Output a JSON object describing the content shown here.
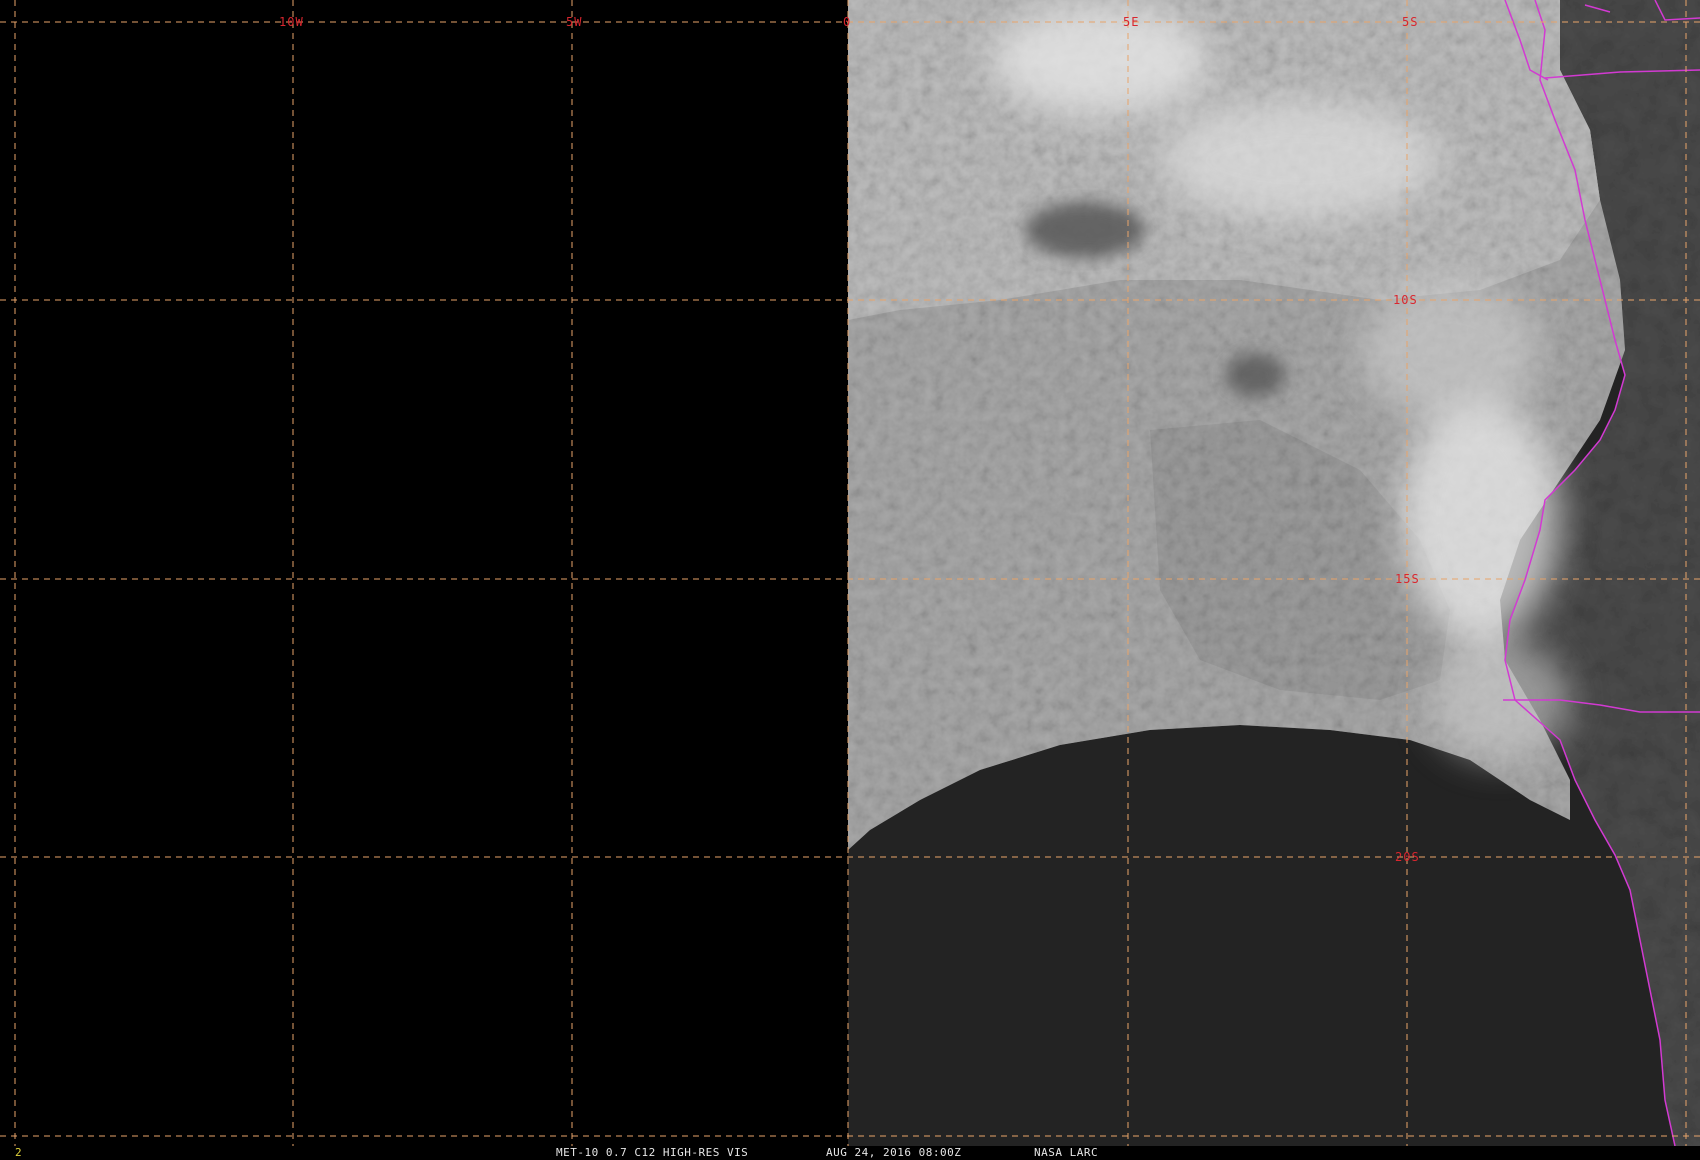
{
  "grid_labels": {
    "longitude": [
      "10W",
      "5W",
      "0",
      "5E",
      "5S"
    ],
    "latitude": [
      "10S",
      "15S",
      "20S"
    ]
  },
  "footer": {
    "frame": "2",
    "product": "MET-10 0.7 C12 HIGH-RES VIS",
    "datetime": "AUG 24, 2016 08:00Z",
    "source": "NASA LARC"
  },
  "colors": {
    "background": "#000000",
    "grid": "#e8a46a",
    "grid_labels": "#d9262e",
    "borders": "#d23ad2",
    "footer_text": "#e6e6e6",
    "frame_number": "#e0d33a"
  }
}
